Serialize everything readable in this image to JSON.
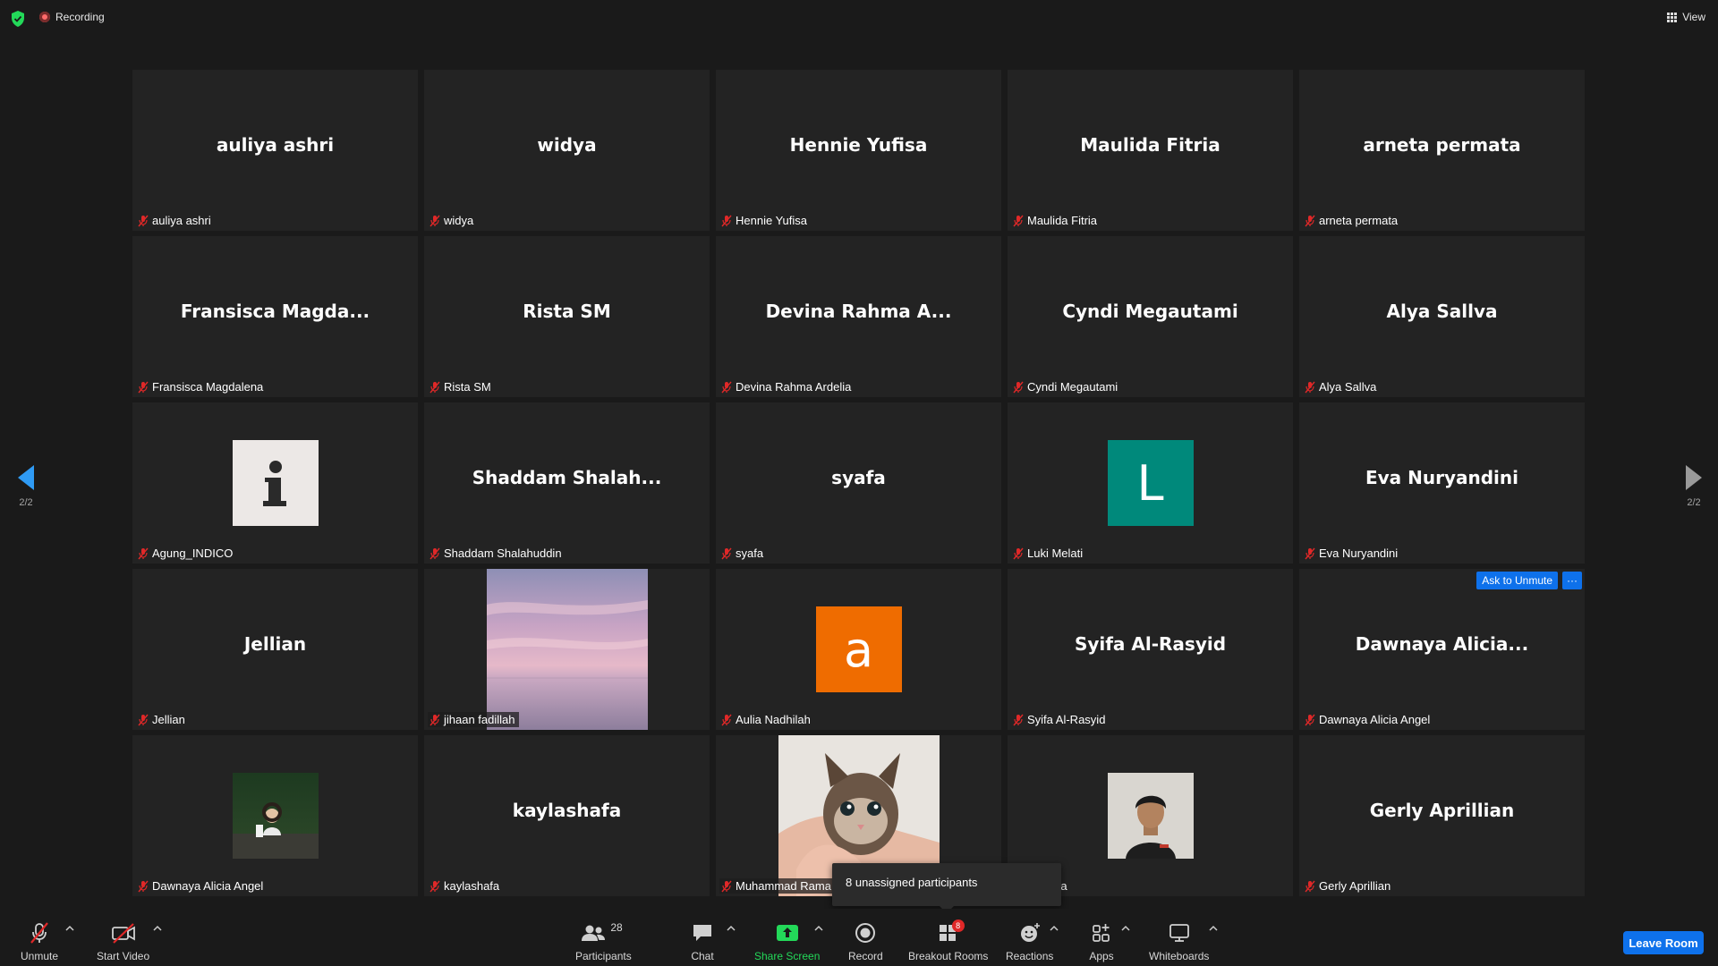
{
  "topbar": {
    "recording_label": "Recording",
    "view_label": "View"
  },
  "page_nav": {
    "left_page": "2/2",
    "right_page": "2/2"
  },
  "tiles": [
    {
      "name": "auliya ashri",
      "label": "auliya ashri"
    },
    {
      "name": "widya",
      "label": "widya"
    },
    {
      "name": "Hennie Yufisa",
      "label": "Hennie Yufisa"
    },
    {
      "name": "Maulida Fitria",
      "label": "Maulida Fitria"
    },
    {
      "name": "arneta permata",
      "label": "arneta permata"
    },
    {
      "name": "Fransisca  Magda...",
      "label": "Fransisca Magdalena"
    },
    {
      "name": "Rista SM",
      "label": "Rista SM"
    },
    {
      "name": "Devina  Rahma  A...",
      "label": "Devina Rahma Ardelia"
    },
    {
      "name": "Cyndi Megautami",
      "label": "Cyndi Megautami"
    },
    {
      "name": "Alya Sallva",
      "label": "Alya Sallva"
    },
    {
      "avatar": "info-logo-icon",
      "label": "Agung_INDICO"
    },
    {
      "name": "Shaddam  Shalah...",
      "label": "Shaddam Shalahuddin"
    },
    {
      "name": "syafa",
      "label": "syafa"
    },
    {
      "avatar_letter": "L",
      "avatar_color": "#00897b",
      "label": "Luki Melati"
    },
    {
      "name": "Eva Nuryandini",
      "label": "Eva Nuryandini"
    },
    {
      "name": "Jellian",
      "label": "Jellian"
    },
    {
      "photo": "pink-sunset-sea-photo",
      "label": "jihaan fadillah"
    },
    {
      "avatar_letter": "a",
      "avatar_color": "#ef6c00",
      "label": "Aulia Nadhilah"
    },
    {
      "name": "Syifa Al-Rasyid",
      "label": "Syifa Al-Rasyid"
    },
    {
      "name": "Dawnaya  Alicia...",
      "label": "Dawnaya Alicia Angel",
      "ask_unmute": "Ask to Unmute",
      "more": "···"
    },
    {
      "avatar": "girl-cafe-photo",
      "label": "Dawnaya Alicia Angel"
    },
    {
      "name": "kaylashafa",
      "label": "kaylashafa"
    },
    {
      "photo": "kitten-in-hand-photo",
      "label": "Muhammad Rama"
    },
    {
      "avatar": "young-man-photo",
      "label": "ar Yuda"
    },
    {
      "name": "Gerly Aprillian",
      "label": "Gerly Aprillian"
    }
  ],
  "tooltip": {
    "text": "8 unassigned participants"
  },
  "toolbar": {
    "unmute": "Unmute",
    "start_video": "Start Video",
    "participants": "Participants",
    "participants_count": "28",
    "chat": "Chat",
    "share_screen": "Share Screen",
    "record": "Record",
    "breakout_rooms": "Breakout Rooms",
    "breakout_badge": "8",
    "reactions": "Reactions",
    "apps": "Apps",
    "whiteboards": "Whiteboards",
    "leave": "Leave Room"
  },
  "colors": {
    "background": "#1a1a1a",
    "tile": "#232323",
    "accent_blue": "#0e71eb",
    "share_green": "#23d959",
    "mute_red": "#e02828"
  }
}
